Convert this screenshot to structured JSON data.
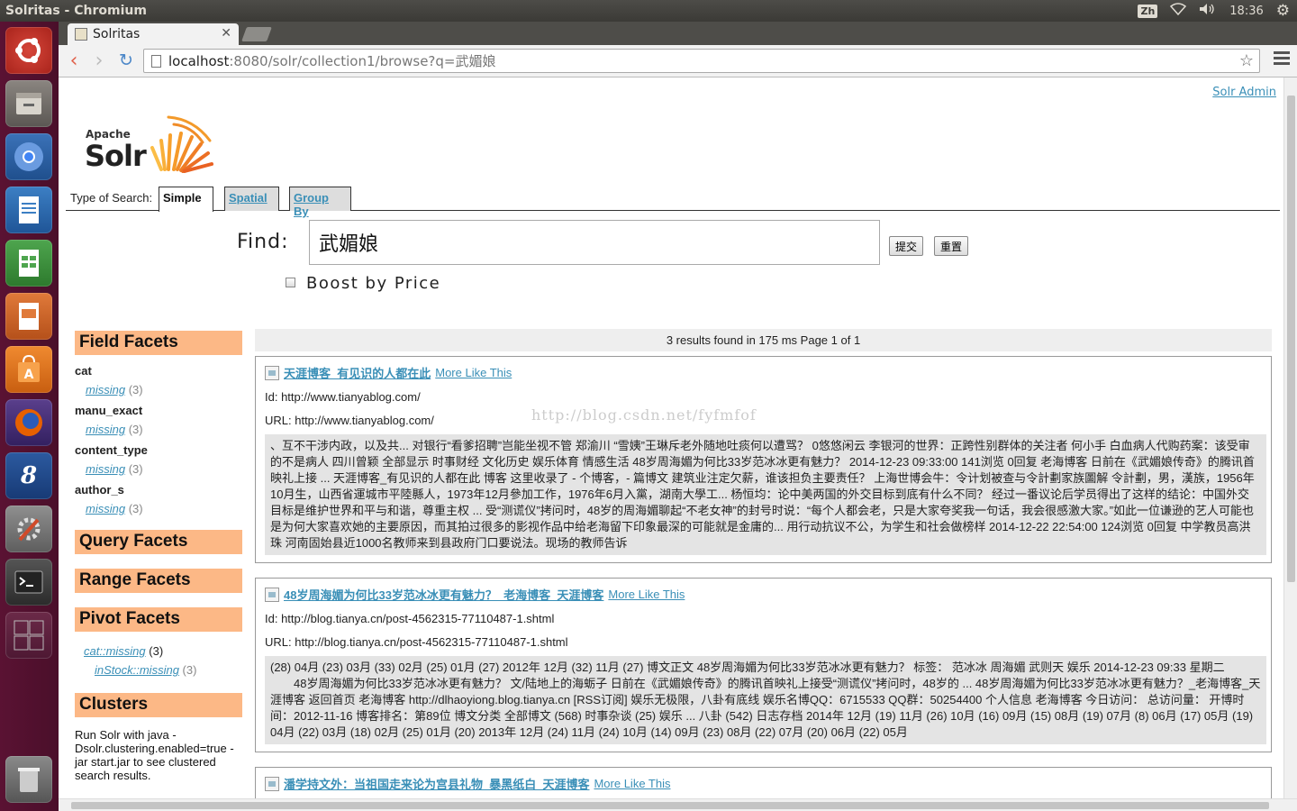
{
  "os": {
    "window_title": "Solritas - Chromium",
    "lang": "Zh",
    "time": "18:36"
  },
  "browser": {
    "tab_title": "Solritas",
    "url_host": "localhost",
    "url_rest": ":8080/solr/collection1/browse?q=武媚娘"
  },
  "page": {
    "admin_link": "Solr Admin",
    "logo_apache": "Apache",
    "logo_solr": "Solr",
    "search_type_label": "Type of Search:",
    "search_tabs": [
      "Simple",
      "Spatial",
      "Group By"
    ],
    "find_label": "Find:",
    "query": "武媚娘",
    "submit": "提交",
    "reset": "重置",
    "boost_label": "Boost by Price"
  },
  "facets": {
    "field_title": "Field Facets",
    "fields": [
      {
        "name": "cat",
        "value": "missing",
        "count": "(3)"
      },
      {
        "name": "manu_exact",
        "value": "missing",
        "count": "(3)"
      },
      {
        "name": "content_type",
        "value": "missing",
        "count": "(3)"
      },
      {
        "name": "author_s",
        "value": "missing",
        "count": "(3)"
      }
    ],
    "query_title": "Query Facets",
    "range_title": "Range Facets",
    "pivot_title": "Pivot Facets",
    "pivot": [
      {
        "value": "cat::missing",
        "count": "(3)"
      },
      {
        "value": "inStock::missing",
        "count": "(3)"
      }
    ],
    "clusters_title": "Clusters",
    "clusters_text": "Run Solr with java -Dsolr.clustering.enabled=true -jar start.jar to see clustered search results."
  },
  "results": {
    "summary": "3 results found in 175 ms Page 1 of 1",
    "more_like_this": "More Like This",
    "docs": [
      {
        "title": "天涯博客_有见识的人都在此",
        "id": "Id: http://www.tianyablog.com/",
        "url": "URL: http://www.tianyablog.com/",
        "snippet": "、互不干涉内政，以及共... 对银行“看爹招聘”岂能坐视不管 郑渝川 “雪姨”王琳斥老外随地吐痰何以遭骂？ 0悠悠闲云 李银河的世界：正跨性别群体的关注者 何小手 白血病人代购药案：该受审的不是病人 四川曾颖 全部显示 时事财经 文化历史 娱乐体育 情感生活 48岁周海媚为何比33岁范冰冰更有魅力？ 2014-12-23 09:33:00 141浏览 0回复 老海博客 日前在《武媚娘传奇》的腾讯首映礼上接 ... 天涯博客_有见识的人都在此 博客 这里收录了 - 个博客，- 篇博文 建筑业注定欠薪，谁该担负主要责任？ 上海世博会牛：令计划被查与令計劃家族圖解 令計劃，男，漢族，1956年10月生，山西省運城市平陸縣人，1973年12月參加工作，1976年6月入黨，湖南大學工... 杨恒均：论中美两国的外交目标到底有什么不同？ 经过一番议论后学员得出了这样的结论：中国外交目标是维护世界和平与和谐，尊重主权 ... 受“测谎仪”拷问时，48岁的周海媚聊起“不老女神”的封号时说：“每个人都会老，只是大家夸奖我一句话，我会很感激大家。”如此一位谦逊的艺人可能也是为何大家喜欢她的主要原因，而其拍过很多的影视作品中给老海留下印象最深的可能就是金庸的... 用行动抗议不公，为学生和社会做榜样 2014-12-22 22:54:00 124浏览 0回复 中学教员高洪珠 河南固始县近1000名教师来到县政府门口要说法。现场的教师告诉"
      },
      {
        "title": "48岁周海媚为何比33岁范冰冰更有魅力？_老海博客_天涯博客",
        "id": "Id: http://blog.tianya.cn/post-4562315-77110487-1.shtml",
        "url": "URL: http://blog.tianya.cn/post-4562315-77110487-1.shtml",
        "snippet": "(28) 04月 (23) 03月 (33) 02月 (25) 01月 (27) 2012年 12月 (32) 11月 (27) 博文正文 48岁周海媚为何比33岁范冰冰更有魅力？   标签： 范冰冰 周海媚 武则天 娱乐 2014-12-23 09:33 星期二 　　48岁周海媚为何比33岁范冰冰更有魅力？ 文/陆地上的海蛎子   日前在《武媚娘传奇》的腾讯首映礼上接受“测谎仪”拷问时，48岁的 ... 48岁周海媚为何比33岁范冰冰更有魅力？_老海博客_天涯博客 返回首页 老海博客 http://dlhaoyiong.blog.tianya.cn [RSS订阅] 娱乐无极限，八卦有底线 娱乐名博QQ：6715533 QQ群：50254400 个人信息 老海博客 今日访问： 总访问量： 开博时间：2012-11-16 博客排名：第89位 博文分类 全部博文 (568) 时事杂谈 (25) 娱乐 ... 八卦 (542) 日志存档 2014年 12月 (19) 11月 (26) 10月 (16) 09月 (15) 08月 (19) 07月 (8) 06月 (17) 05月 (19) 04月 (22) 03月 (18) 02月 (25) 01月 (20) 2013年 12月 (24) 11月 (24) 10月 (14) 09月 (23) 08月 (22) 07月 (20) 06月 (22) 05月"
      },
      {
        "title": "潘学持文外：当祖国走来论为宫县礼物_暴黑纸白_天涯博客"
      }
    ]
  },
  "watermark": "http://blog.csdn.net/fyfmfof"
}
